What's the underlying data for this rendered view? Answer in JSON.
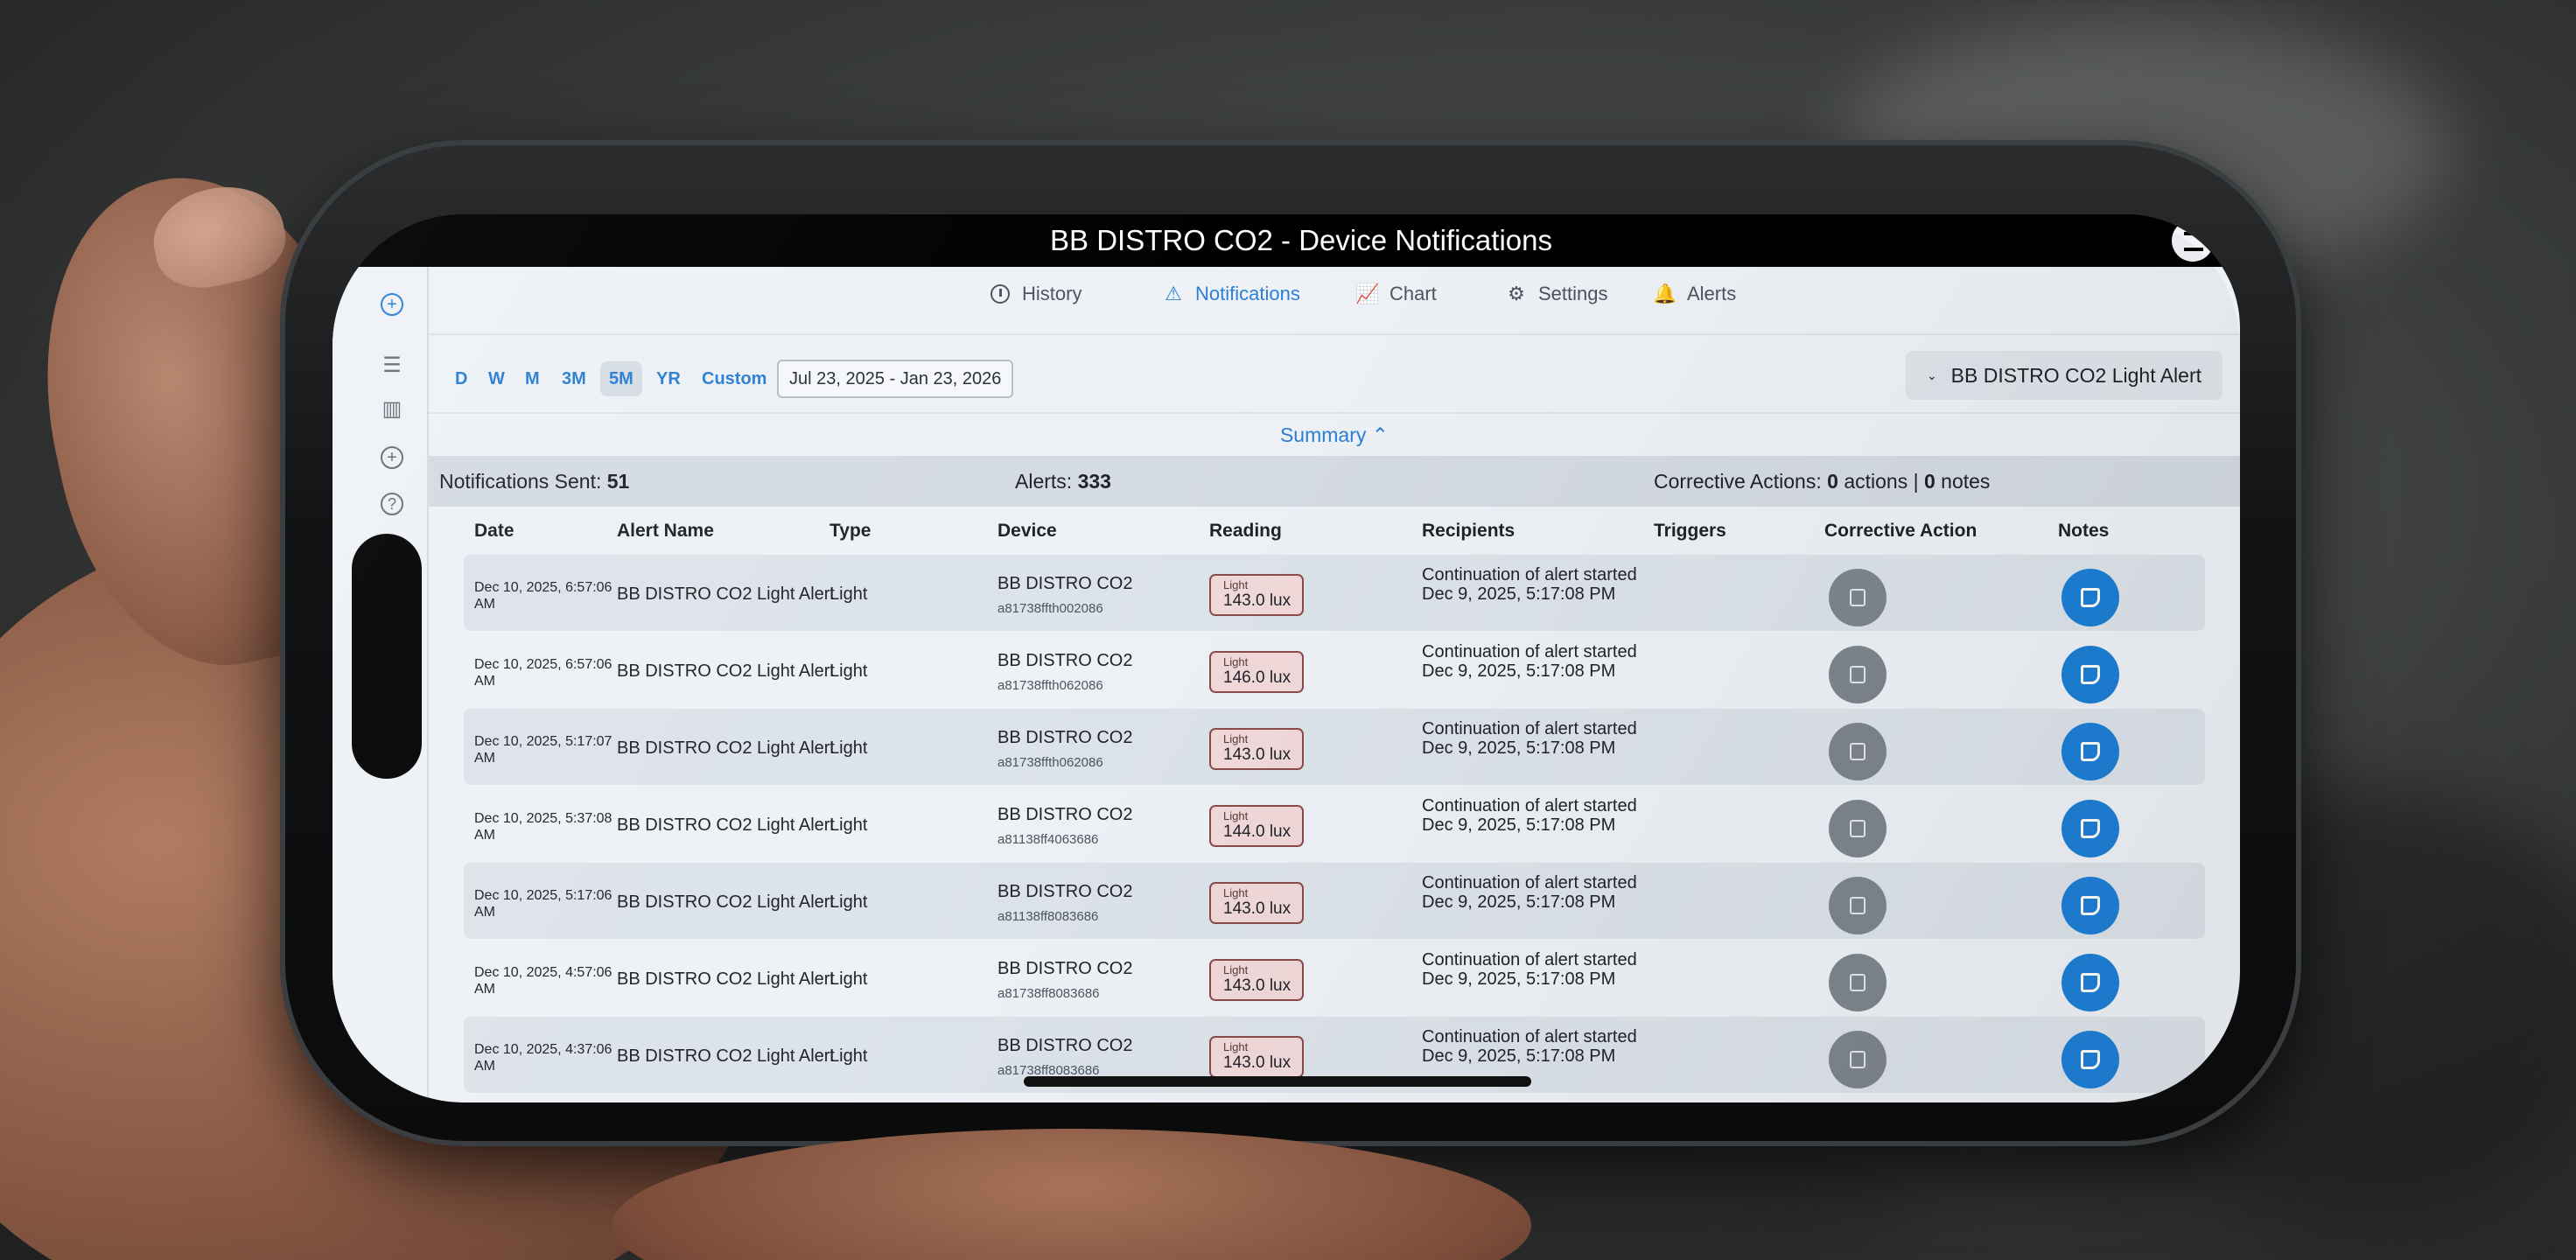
{
  "window": {
    "title": "BB DISTRO CO2 - Device Notifications"
  },
  "nav": {
    "history": "History",
    "notifications": "Notifications",
    "chart": "Chart",
    "settings": "Settings",
    "alerts": "Alerts",
    "active": "Notifications"
  },
  "filters": {
    "ranges": [
      "D",
      "W",
      "M",
      "3M",
      "5M",
      "YR",
      "Custom"
    ],
    "selected_range": "5M",
    "date_range": "Jul 23, 2025 - Jan 23, 2026",
    "alert_selector": "BB DISTRO CO2 Light Alert"
  },
  "summary": {
    "toggle_label": "Summary",
    "notifications_sent_label": "Notifications Sent:",
    "notifications_sent": "51",
    "alerts_label": "Alerts:",
    "alerts": "333",
    "corrective_label": "Corrective Actions:",
    "corrective_actions": "0",
    "actions_word": "actions |",
    "notes_count": "0",
    "notes_word": "notes"
  },
  "table": {
    "headers": [
      "Date",
      "Alert Name",
      "Type",
      "Device",
      "Reading",
      "Recipients",
      "Triggers",
      "Corrective Action",
      "Notes"
    ],
    "rows": [
      {
        "date": "Dec 10, 2025, 6:57:06 AM",
        "name": "BB DISTRO CO2 Light Alert",
        "type": "Light",
        "device": "BB DISTRO CO2",
        "device_id": "a81738ffth002086",
        "reading_label": "Light",
        "reading": "143.0 lux",
        "recipients": "Continuation of alert started Dec 9, 2025, 5:17:08 PM"
      },
      {
        "date": "Dec 10, 2025, 6:57:06 AM",
        "name": "BB DISTRO CO2 Light Alert",
        "type": "Light",
        "device": "BB DISTRO CO2",
        "device_id": "a81738ffth062086",
        "reading_label": "Light",
        "reading": "146.0 lux",
        "recipients": "Continuation of alert started Dec 9, 2025, 5:17:08 PM"
      },
      {
        "date": "Dec 10, 2025, 5:17:07 AM",
        "name": "BB DISTRO CO2 Light Alert",
        "type": "Light",
        "device": "BB DISTRO CO2",
        "device_id": "a81738ffth062086",
        "reading_label": "Light",
        "reading": "143.0 lux",
        "recipients": "Continuation of alert started Dec 9, 2025, 5:17:08 PM"
      },
      {
        "date": "Dec 10, 2025, 5:37:08 AM",
        "name": "BB DISTRO CO2 Light Alert",
        "type": "Light",
        "device": "BB DISTRO CO2",
        "device_id": "a81138ff4063686",
        "reading_label": "Light",
        "reading": "144.0 lux",
        "recipients": "Continuation of alert started Dec 9, 2025, 5:17:08 PM"
      },
      {
        "date": "Dec 10, 2025, 5:17:06 AM",
        "name": "BB DISTRO CO2 Light Alert",
        "type": "Light",
        "device": "BB DISTRO CO2",
        "device_id": "a81138ff8083686",
        "reading_label": "Light",
        "reading": "143.0 lux",
        "recipients": "Continuation of alert started Dec 9, 2025, 5:17:08 PM"
      },
      {
        "date": "Dec 10, 2025, 4:57:06 AM",
        "name": "BB DISTRO CO2 Light Alert",
        "type": "Light",
        "device": "BB DISTRO CO2",
        "device_id": "a81738ff8083686",
        "reading_label": "Light",
        "reading": "143.0 lux",
        "recipients": "Continuation of alert started Dec 9, 2025, 5:17:08 PM"
      },
      {
        "date": "Dec 10, 2025, 4:37:06 AM",
        "name": "BB DISTRO CO2 Light Alert",
        "type": "Light",
        "device": "BB DISTRO CO2",
        "device_id": "a81738ff8083686",
        "reading_label": "Light",
        "reading": "143.0 lux",
        "recipients": "Continuation of alert started Dec 9, 2025, 5:17:08 PM"
      }
    ]
  },
  "colors": {
    "accent": "#2b7fd4",
    "note_button": "#1d7fd6",
    "corrective_button": "#7d858e",
    "reading_badge_bg": "#f1d9da",
    "reading_badge_border": "#8c4a4a"
  },
  "icons": {
    "rail": [
      "add-circle-icon",
      "menu-icon",
      "book-icon",
      "plus-circle-icon",
      "help-icon"
    ],
    "nav": [
      "clock-icon",
      "warning-icon",
      "chart-line-icon",
      "gear-icon",
      "bell-icon"
    ],
    "row_actions": [
      "copy-icon",
      "note-icon"
    ]
  }
}
